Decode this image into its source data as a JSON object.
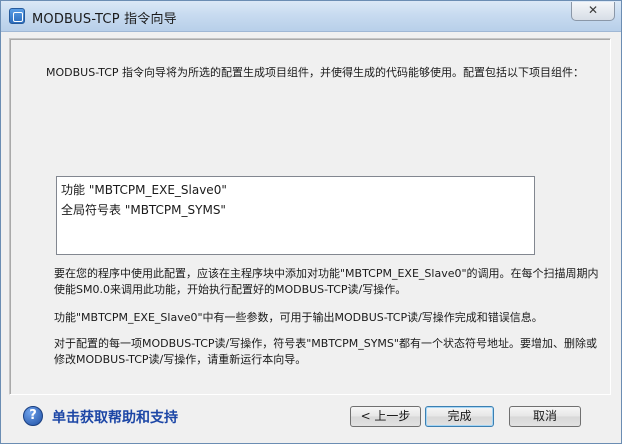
{
  "window": {
    "title": "MODBUS-TCP 指令向导",
    "close_symbol": "✕"
  },
  "icons": {
    "app": "wizard-app-icon",
    "close": "close-icon",
    "help": "help-question-icon",
    "help_glyph": "?"
  },
  "colors": {
    "help_link": "#1c46a6",
    "titlebar": "#c8dbf0"
  },
  "main": {
    "intro": "MODBUS-TCP 指令向导将为所选的配置生成项目组件，并使得生成的代码能够使用。配置包括以下项目组件：",
    "components": [
      "功能 \"MBTCPM_EXE_Slave0\"",
      "全局符号表 \"MBTCPM_SYMS\""
    ],
    "paragraph1": "要在您的程序中使用此配置，应该在主程序块中添加对功能\"MBTCPM_EXE_Slave0\"的调用。在每个扫描周期内使能SM0.0来调用此功能，开始执行配置好的MODBUS-TCP读/写操作。",
    "paragraph2": "功能\"MBTCPM_EXE_Slave0\"中有一些参数，可用于输出MODBUS-TCP读/写操作完成和错误信息。",
    "paragraph3": "对于配置的每一项MODBUS-TCP读/写操作，符号表\"MBTCPM_SYMS\"都有一个状态符号地址。要增加、删除或修改MODBUS-TCP读/写操作，请重新运行本向导。"
  },
  "footer": {
    "help_link": "单击获取帮助和支持",
    "back_button": "< 上一步",
    "finish_button": "完成",
    "cancel_button": "取消"
  }
}
